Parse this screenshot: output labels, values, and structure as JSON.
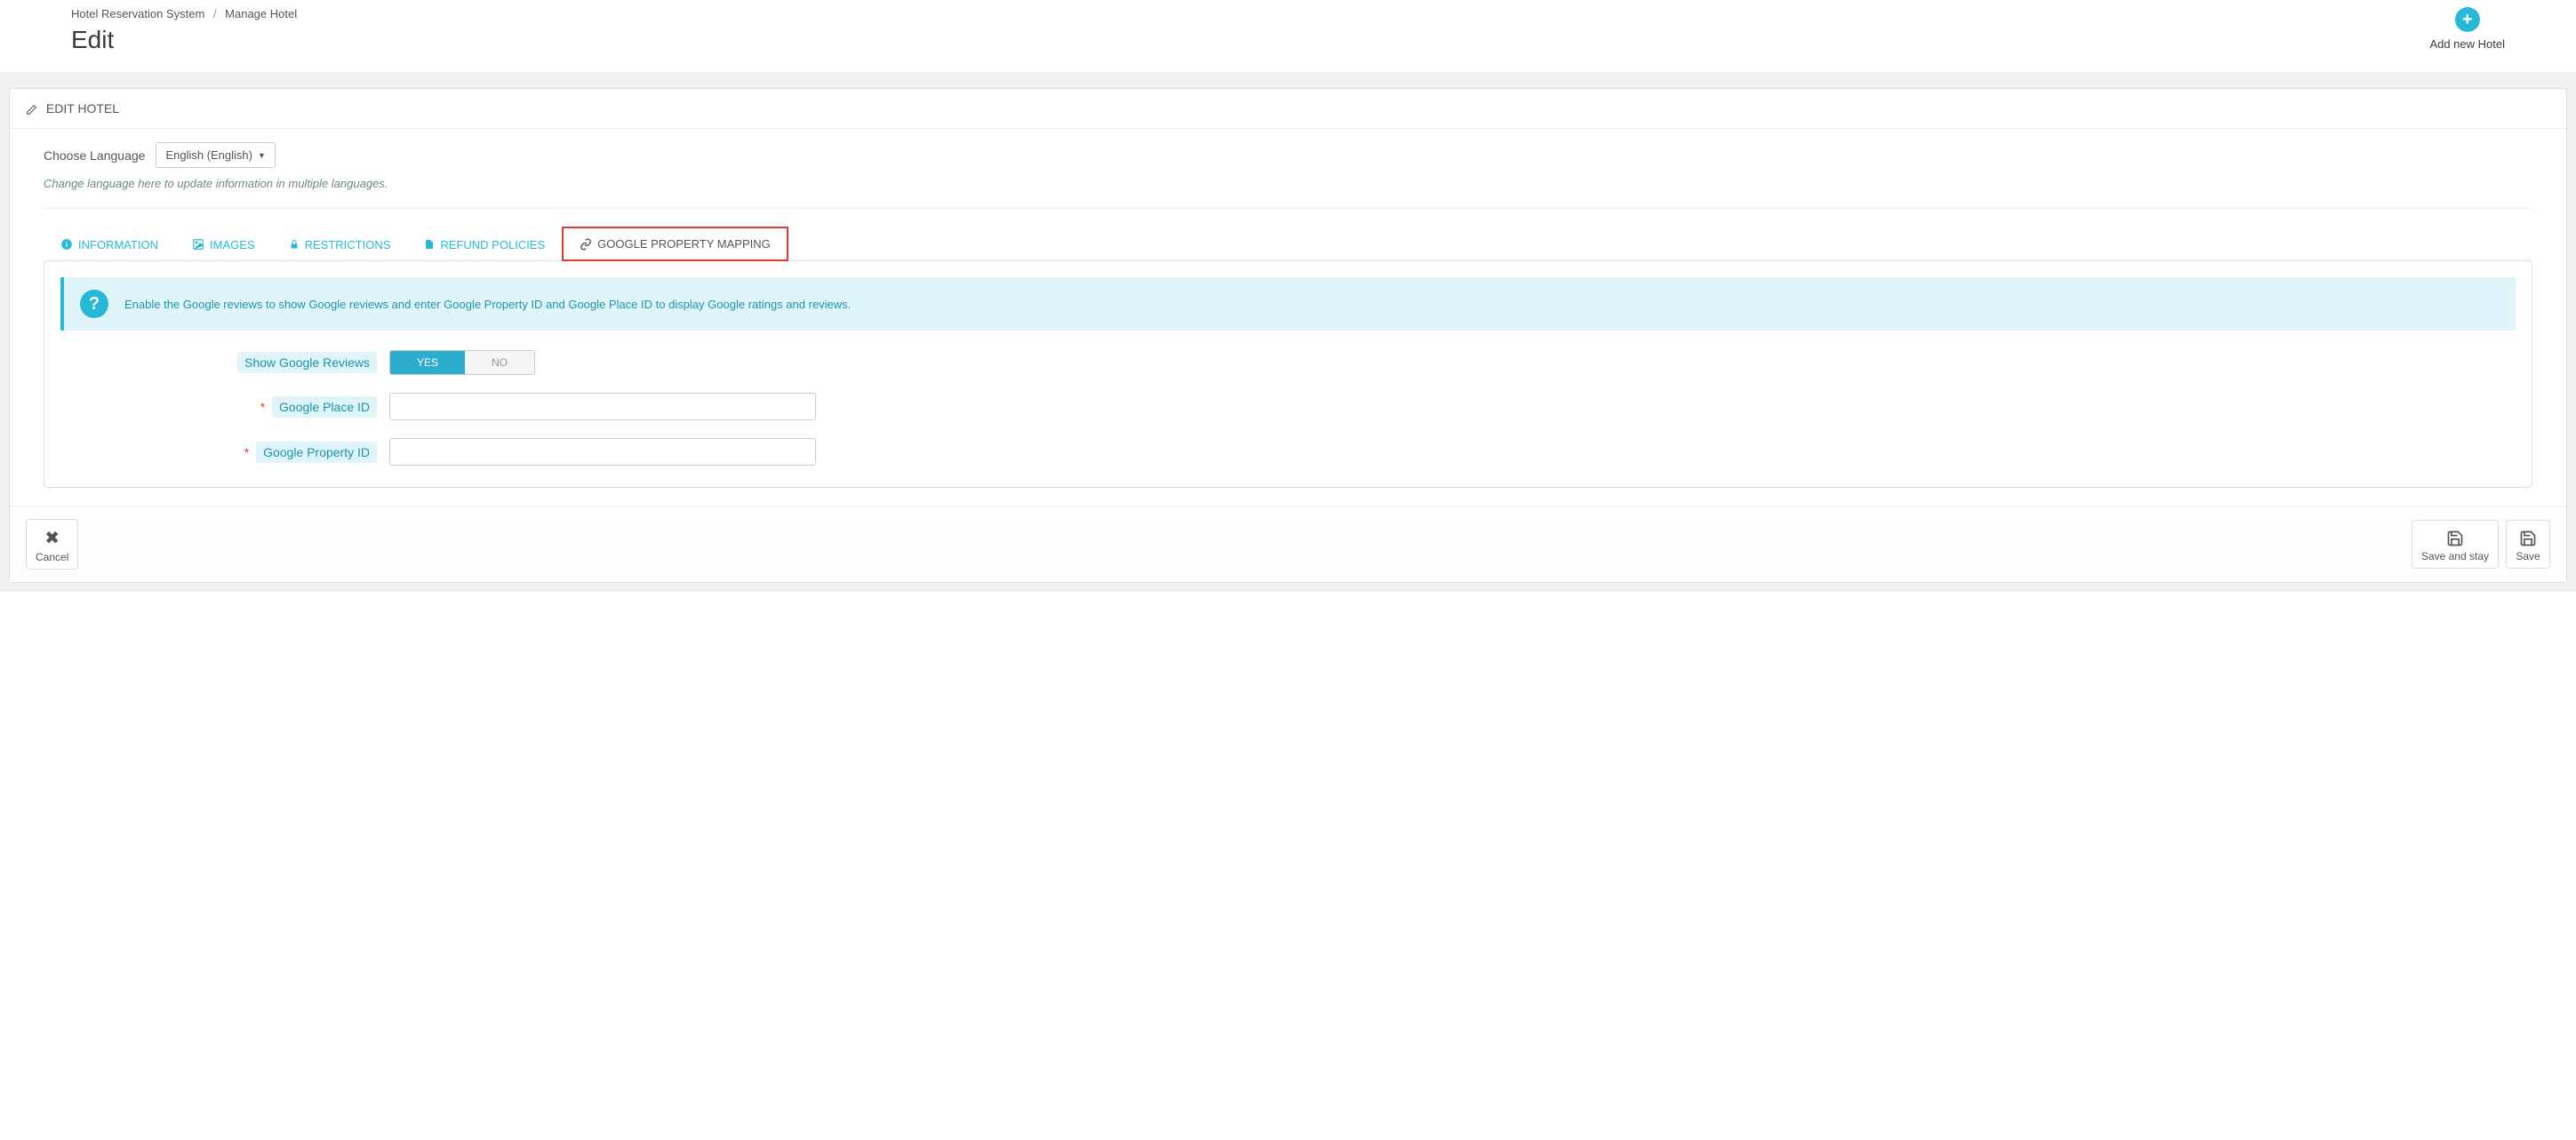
{
  "breadcrumb": {
    "root": "Hotel Reservation System",
    "current": "Manage Hotel"
  },
  "page_title": "Edit",
  "add_hotel_label": "Add new Hotel",
  "panel_title": "EDIT HOTEL",
  "language": {
    "label": "Choose Language",
    "selected": "English (English)",
    "help": "Change language here to update information in multiple languages."
  },
  "tabs": {
    "information": "INFORMATION",
    "images": "IMAGES",
    "restrictions": "RESTRICTIONS",
    "refund": "REFUND POLICIES",
    "google": "GOOGLE PROPERTY MAPPING"
  },
  "banner": "Enable the Google reviews to show Google reviews and enter Google Property ID and Google Place ID to display Google ratings and reviews.",
  "form": {
    "show_reviews_label": "Show Google Reviews",
    "yes": "YES",
    "no": "NO",
    "place_id_label": "Google Place ID",
    "place_id_value": "",
    "property_id_label": "Google Property ID",
    "property_id_value": ""
  },
  "footer": {
    "cancel": "Cancel",
    "save_stay": "Save and stay",
    "save": "Save"
  }
}
